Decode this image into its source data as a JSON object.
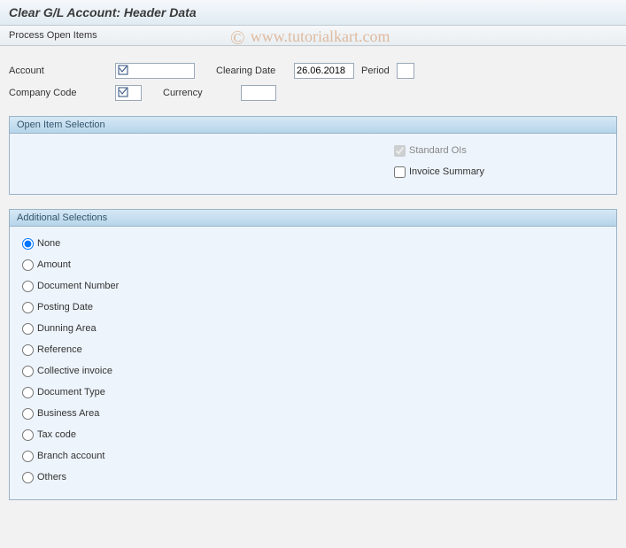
{
  "header": {
    "title": "Clear G/L Account: Header Data"
  },
  "toolbar": {
    "process_open_items": "Process Open Items"
  },
  "fields": {
    "account_label": "Account",
    "account_value": "",
    "company_code_label": "Company Code",
    "company_code_value": "",
    "clearing_date_label": "Clearing Date",
    "clearing_date_value": "26.06.2018",
    "period_label": "Period",
    "period_value": "",
    "currency_label": "Currency",
    "currency_value": ""
  },
  "open_item_selection": {
    "title": "Open Item Selection",
    "standard_ois_label": "Standard OIs",
    "standard_ois_checked": true,
    "standard_ois_disabled": true,
    "invoice_summary_label": "Invoice Summary",
    "invoice_summary_checked": false
  },
  "additional_selections": {
    "title": "Additional Selections",
    "selected": "None",
    "options": [
      "None",
      "Amount",
      "Document Number",
      "Posting Date",
      "Dunning Area",
      "Reference",
      "Collective invoice",
      "Document Type",
      "Business Area",
      "Tax code",
      "Branch account",
      "Others"
    ]
  },
  "watermark": {
    "text": "www.tutorialkart.com",
    "symbol": "©"
  }
}
